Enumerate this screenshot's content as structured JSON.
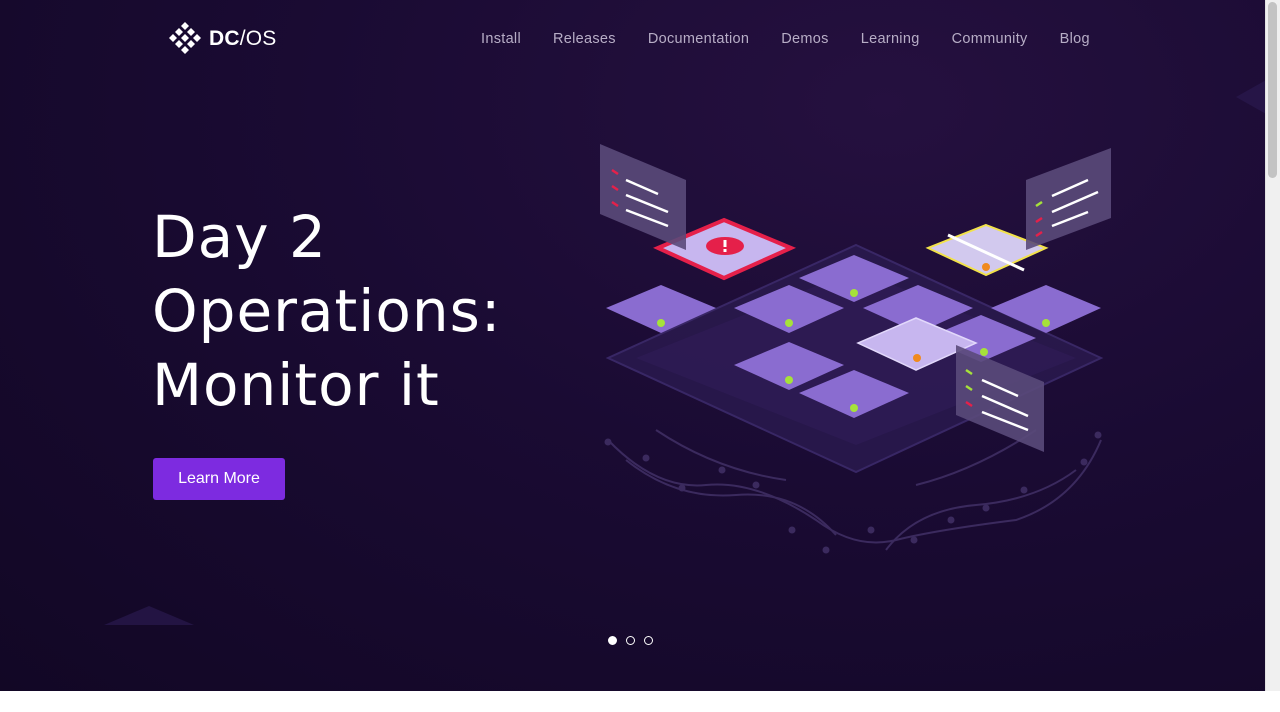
{
  "brand": {
    "mark": "DC",
    "slash": "/OS"
  },
  "nav": {
    "items": [
      {
        "label": "Install"
      },
      {
        "label": "Releases"
      },
      {
        "label": "Documentation"
      },
      {
        "label": "Demos"
      },
      {
        "label": "Learning"
      },
      {
        "label": "Community"
      },
      {
        "label": "Blog"
      }
    ]
  },
  "hero": {
    "headline_lines": [
      "Day 2",
      "Operations:",
      "Monitor it"
    ],
    "cta_label": "Learn More"
  },
  "carousel": {
    "slide_count": 3,
    "active_index": 0
  },
  "colors": {
    "background": "#1a0b33",
    "accent": "#7d2be0",
    "tile": "#8a6cd0",
    "alert": "#e5204a",
    "ok": "#a6e23a",
    "warn": "#f08a1e",
    "highlight": "#f2e24a"
  },
  "icons": [
    "dcos-logo-icon",
    "cluster-illustration",
    "alert-icon"
  ]
}
